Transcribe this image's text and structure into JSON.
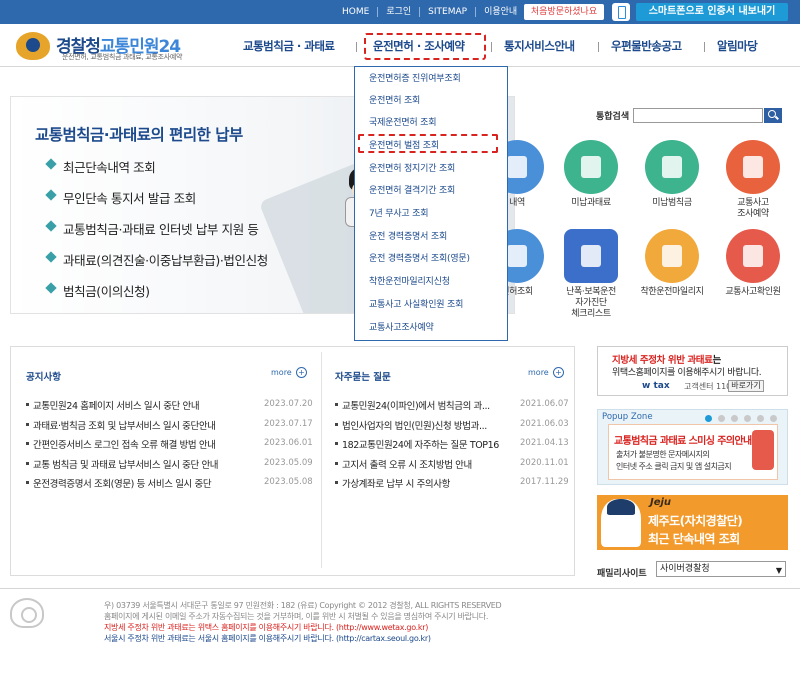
{
  "top_links": [
    "HOME",
    "로그인",
    "SITEMAP",
    "이용안내"
  ],
  "top_special": "처음방문하셨나요",
  "smart_login": "스마트폰으로 인증서 내보내기",
  "logo": {
    "brand1": "경찰청",
    "brand2": "교통민원24",
    "sub": "운전면허, 교통범칙금 과태료, 교통조사예약"
  },
  "nav": [
    "교통범칙금 · 과태료",
    "운전면허 · 조사예약",
    "통지서비스안내",
    "우편물반송공고",
    "알림마당"
  ],
  "dropdown": [
    "운전면허증 진위여부조회",
    "운전면허 조회",
    "국제운전면허 조회",
    "운전면허 벌점 조회",
    "운전면허 정지기간 조회",
    "운전면허 결격기간 조회",
    "7년 무사고 조회",
    "운전 경력증명서 조회",
    "운전 경력증명서 조회(영문)",
    "착한운전마일리지신청",
    "교통사고 사실확인원 조회",
    "교통사고조사예약"
  ],
  "banner": {
    "title": "교통범칙금·과태료의 편리한 납부",
    "items": [
      "최근단속내역 조회",
      "무인단속 통지서 발급 조회",
      "교통범칙금·과태료 인터넷 납부 지원 등",
      "과태료(의견진술·이중납부환급)·법인신청",
      "범칙금(이의신청)"
    ]
  },
  "search": {
    "label": "통합검색",
    "value": ""
  },
  "services_row1": [
    {
      "label": "내역",
      "color": "#4a90d9"
    },
    {
      "label": "미납과태료",
      "color": "#3db38e"
    },
    {
      "label": "미납범칙금",
      "color": "#3db38e"
    },
    {
      "label": "교통사고\n조사예약",
      "color": "#e8623e"
    }
  ],
  "services_row2": [
    {
      "label": "면허조회",
      "color": "#4a90d9"
    },
    {
      "label": "난폭·보복운전\n자가진단\n체크리스트",
      "color": "#3c6fc9"
    },
    {
      "label": "착한운전마일리지",
      "color": "#f2a93b"
    },
    {
      "label": "교통사고확인원",
      "color": "#e55a4a"
    }
  ],
  "notices": {
    "title": "공지사항",
    "more": "more",
    "rows": [
      {
        "title": "교통민원24 홈페이지 서비스 일시 중단 안내",
        "date": "2023.07.20"
      },
      {
        "title": "과태료·범칙금 조회 및 납부서비스 일시 중단안내",
        "date": "2023.07.17"
      },
      {
        "title": "간편인증서비스 로그인 접속 오류 해결 방법 안내",
        "date": "2023.06.01"
      },
      {
        "title": "교통 범칙금 및 과태료 납부서비스 일시 중단 안내",
        "date": "2023.05.09"
      },
      {
        "title": "운전경력증명서 조회(영문) 등 서비스 일시 중단",
        "date": "2023.05.08"
      }
    ]
  },
  "faq": {
    "title": "자주묻는 질문",
    "more": "more",
    "rows": [
      {
        "title": "교통민원24(이파인)에서 범칙금의 과...",
        "date": "2021.06.07"
      },
      {
        "title": "법인사업자의 법인(민원)신청 방법과...",
        "date": "2021.06.03"
      },
      {
        "title": "182교통민원24에 자주하는 질문 TOP16",
        "date": "2021.04.13"
      },
      {
        "title": "고지서 출력 오류 시 조치방법 안내",
        "date": "2020.11.01"
      },
      {
        "title": "가상계좌로 납부 시 주의사항",
        "date": "2017.11.29"
      }
    ]
  },
  "ad_wetax": {
    "line1_red": "지방세 주정차 위반 과태료",
    "line1_rest": "는",
    "line2": "위택스홈페이지를 이용해주시기 바랍니다.",
    "logo": "w tax",
    "phone": "고객센터 110번",
    "button": "바로가기"
  },
  "popup": {
    "title": "Popup Zone",
    "heading": "교통범칙금 과태료 스미싱 주의안내",
    "lines": [
      "출처가 불분명한 문자메시지의",
      "인터넷 주소 클릭 금지 및 앱 설치금지"
    ]
  },
  "jeju": {
    "logo": "Jeju",
    "line1": "제주도(자치경찰단)",
    "line2": "최근 단속내역 조회"
  },
  "family_site": {
    "label": "패밀리사이트",
    "selected": "사이버경찰청"
  },
  "footer": {
    "address": "우) 03739 서울특별시 서대문구 통일로 97   민원전화 : 182 (유료)        Copyright © 2012 경찰청, ALL RIGHTS RESERVED",
    "notice": "홈페이지에 게시된 이메일 주소가 자동수집되는 것을 거부하며, 이를 위반 시 처벌될 수 있음을 명심하여 주시기 바랍니다.",
    "red": "지방세 주정차 위반 과태료는 위택스 홈페이지를 이용해주시기 바랍니다. (http://www.wetax.go.kr)",
    "blue": "서울시 주정차 위반 과태료는 서울시 홈페이지를 이용해주시기 바랍니다. (http://cartax.seoul.go.kr)"
  }
}
